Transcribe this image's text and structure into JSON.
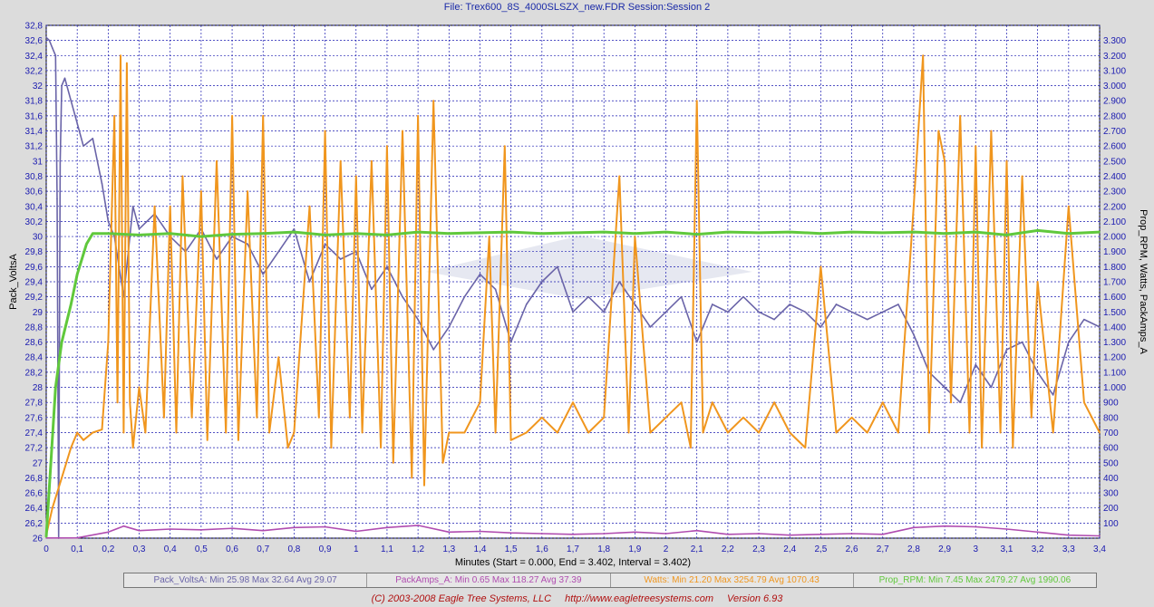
{
  "header": {
    "title": "File: Trex600_8S_4000SLSZX_new.FDR   Session:Session 2"
  },
  "footer": {
    "copyright": "(C) 2003-2008 Eagle Tree Systems, LLC",
    "url": "http://www.eagletreesystems.com",
    "version": "Version 6.93"
  },
  "legend": [
    {
      "text": "Pack_VoltsA:  Min 25.98    Max 32.64    Avg 29.07",
      "color": "#6a64a8"
    },
    {
      "text": "PackAmps_A:  Min 0.65    Max 118.27    Avg 37.39",
      "color": "#b04cb0"
    },
    {
      "text": "Watts:  Min 21.20    Max 3254.79    Avg 1070.43",
      "color": "#f0961e"
    },
    {
      "text": "Prop_RPM:  Min 7.45    Max 2479.27    Avg 1990.06",
      "color": "#60c83c"
    }
  ],
  "chart_data": {
    "type": "line",
    "xlabel": "Minutes (Start = 0.000,  End = 3.402,  Interval =  3.402)",
    "ylabel": "Pack_VoltsA",
    "y2label": "Prop_RPM, Watts, PackAmps_A",
    "xlim": [
      0,
      3.4
    ],
    "ylim": [
      26,
      32.8
    ],
    "y2lim": [
      0,
      3400
    ],
    "grid": true,
    "legend_position": "bottom",
    "x_ticks": [
      "0",
      "0,1",
      "0,2",
      "0,3",
      "0,4",
      "0,5",
      "0,6",
      "0,7",
      "0,8",
      "0,9",
      "1",
      "1,1",
      "1,2",
      "1,3",
      "1,4",
      "1,5",
      "1,6",
      "1,7",
      "1,8",
      "1,9",
      "2",
      "2,1",
      "2,2",
      "2,3",
      "2,4",
      "2,5",
      "2,6",
      "2,7",
      "2,8",
      "2,9",
      "3",
      "3,1",
      "3,2",
      "3,3",
      "3,4"
    ],
    "y_ticks": [
      "26",
      "26,2",
      "26,4",
      "26,6",
      "26,8",
      "27",
      "27,2",
      "27,4",
      "27,6",
      "27,8",
      "28",
      "28,2",
      "28,4",
      "28,6",
      "28,8",
      "29",
      "29,2",
      "29,4",
      "29,6",
      "29,8",
      "30",
      "30,2",
      "30,4",
      "30,6",
      "30,8",
      "31",
      "31,2",
      "31,4",
      "31,6",
      "31,8",
      "32",
      "32,2",
      "32,4",
      "32,6",
      "32,8"
    ],
    "y2_ticks": [
      "100",
      "200",
      "300",
      "400",
      "500",
      "600",
      "700",
      "800",
      "900",
      "1.000",
      "1.100",
      "1.200",
      "1.300",
      "1.400",
      "1.500",
      "1.600",
      "1.700",
      "1.800",
      "1.900",
      "2.000",
      "2.100",
      "2.200",
      "2.300",
      "2.400",
      "2.500",
      "2.600",
      "2.700",
      "2.800",
      "2.900",
      "3.000",
      "3.100",
      "3.200",
      "3.300"
    ],
    "series": [
      {
        "name": "Pack_VoltsA",
        "axis": "left",
        "color": "#6a64a8",
        "x": [
          0,
          0.01,
          0.02,
          0.03,
          0.035,
          0.04,
          0.045,
          0.05,
          0.06,
          0.08,
          0.1,
          0.12,
          0.15,
          0.18,
          0.2,
          0.22,
          0.25,
          0.28,
          0.3,
          0.35,
          0.4,
          0.45,
          0.5,
          0.55,
          0.6,
          0.65,
          0.7,
          0.75,
          0.8,
          0.85,
          0.9,
          0.95,
          1.0,
          1.05,
          1.1,
          1.15,
          1.2,
          1.25,
          1.3,
          1.35,
          1.4,
          1.45,
          1.5,
          1.55,
          1.6,
          1.65,
          1.7,
          1.75,
          1.8,
          1.85,
          1.9,
          1.95,
          2.0,
          2.05,
          2.1,
          2.15,
          2.2,
          2.25,
          2.3,
          2.35,
          2.4,
          2.45,
          2.5,
          2.55,
          2.6,
          2.65,
          2.7,
          2.75,
          2.8,
          2.85,
          2.9,
          2.95,
          3.0,
          3.05,
          3.1,
          3.15,
          3.2,
          3.25,
          3.3,
          3.35,
          3.4
        ],
        "y": [
          32.64,
          32.6,
          32.5,
          32.4,
          30.5,
          26.0,
          31.0,
          32.0,
          32.1,
          31.8,
          31.5,
          31.2,
          31.3,
          30.7,
          30.2,
          30.0,
          29.2,
          30.4,
          30.1,
          30.3,
          30.0,
          29.8,
          30.1,
          29.7,
          30.0,
          29.9,
          29.5,
          29.8,
          30.1,
          29.4,
          29.9,
          29.7,
          29.8,
          29.3,
          29.6,
          29.2,
          28.9,
          28.5,
          28.8,
          29.2,
          29.5,
          29.3,
          28.6,
          29.1,
          29.4,
          29.6,
          29.0,
          29.2,
          29.0,
          29.4,
          29.1,
          28.8,
          29.0,
          29.2,
          28.6,
          29.1,
          29.0,
          29.2,
          29.0,
          28.9,
          29.1,
          29.0,
          28.8,
          29.1,
          29.0,
          28.9,
          29.0,
          29.1,
          28.7,
          28.2,
          28.0,
          27.8,
          28.3,
          28.0,
          28.5,
          28.6,
          28.2,
          27.9,
          28.6,
          28.9,
          28.8
        ]
      },
      {
        "name": "PackAmps_A",
        "axis": "right",
        "color": "#b04cb0",
        "x": [
          0,
          0.1,
          0.2,
          0.25,
          0.3,
          0.4,
          0.5,
          0.6,
          0.7,
          0.8,
          0.9,
          1.0,
          1.1,
          1.2,
          1.3,
          1.4,
          1.5,
          1.6,
          1.7,
          1.8,
          1.9,
          2.0,
          2.1,
          2.2,
          2.3,
          2.4,
          2.5,
          2.6,
          2.7,
          2.8,
          2.9,
          3.0,
          3.1,
          3.2,
          3.3,
          3.4
        ],
        "y": [
          1,
          2,
          40,
          80,
          50,
          60,
          55,
          65,
          50,
          70,
          75,
          45,
          70,
          85,
          40,
          45,
          35,
          30,
          25,
          30,
          40,
          30,
          50,
          25,
          30,
          20,
          25,
          30,
          25,
          70,
          80,
          75,
          60,
          40,
          20,
          15
        ]
      },
      {
        "name": "Watts",
        "axis": "right",
        "color": "#f0961e",
        "x": [
          0,
          0.02,
          0.05,
          0.08,
          0.1,
          0.12,
          0.15,
          0.18,
          0.2,
          0.22,
          0.23,
          0.24,
          0.25,
          0.26,
          0.27,
          0.28,
          0.3,
          0.32,
          0.35,
          0.38,
          0.4,
          0.42,
          0.44,
          0.47,
          0.5,
          0.52,
          0.55,
          0.58,
          0.6,
          0.62,
          0.65,
          0.68,
          0.7,
          0.72,
          0.75,
          0.78,
          0.8,
          0.85,
          0.88,
          0.9,
          0.92,
          0.95,
          0.98,
          1.0,
          1.02,
          1.05,
          1.08,
          1.1,
          1.12,
          1.15,
          1.18,
          1.2,
          1.22,
          1.25,
          1.28,
          1.3,
          1.35,
          1.4,
          1.43,
          1.45,
          1.48,
          1.5,
          1.55,
          1.6,
          1.65,
          1.7,
          1.75,
          1.8,
          1.85,
          1.88,
          1.9,
          1.95,
          2.0,
          2.05,
          2.08,
          2.1,
          2.12,
          2.15,
          2.2,
          2.25,
          2.3,
          2.35,
          2.4,
          2.45,
          2.5,
          2.55,
          2.6,
          2.65,
          2.7,
          2.75,
          2.8,
          2.83,
          2.85,
          2.88,
          2.9,
          2.92,
          2.95,
          2.98,
          3.0,
          3.02,
          3.05,
          3.08,
          3.1,
          3.12,
          3.15,
          3.18,
          3.2,
          3.25,
          3.3,
          3.35,
          3.4
        ],
        "y": [
          20,
          200,
          400,
          600,
          700,
          650,
          700,
          720,
          1300,
          2800,
          900,
          3200,
          700,
          3150,
          900,
          600,
          1000,
          700,
          2200,
          800,
          2200,
          700,
          2400,
          800,
          2300,
          650,
          2500,
          700,
          2800,
          650,
          2300,
          800,
          2800,
          700,
          1200,
          600,
          700,
          2200,
          800,
          2700,
          600,
          2500,
          800,
          2400,
          700,
          2500,
          600,
          2600,
          500,
          2700,
          400,
          2800,
          350,
          2900,
          500,
          700,
          700,
          900,
          2000,
          700,
          2600,
          650,
          700,
          800,
          700,
          900,
          700,
          800,
          2400,
          700,
          2000,
          700,
          800,
          900,
          600,
          2900,
          700,
          900,
          700,
          800,
          700,
          900,
          700,
          600,
          1800,
          700,
          800,
          700,
          900,
          700,
          2200,
          3200,
          700,
          2700,
          2500,
          900,
          2800,
          700,
          2600,
          600,
          2700,
          700,
          2500,
          600,
          2400,
          800,
          1700,
          700,
          2200,
          900,
          700
        ]
      },
      {
        "name": "Prop_RPM",
        "axis": "right",
        "color": "#60c83c",
        "x": [
          0,
          0.03,
          0.05,
          0.08,
          0.1,
          0.13,
          0.15,
          0.2,
          0.3,
          0.4,
          0.5,
          0.6,
          0.7,
          0.8,
          0.9,
          1.0,
          1.1,
          1.2,
          1.3,
          1.4,
          1.5,
          1.6,
          1.7,
          1.8,
          1.9,
          2.0,
          2.1,
          2.2,
          2.3,
          2.4,
          2.5,
          2.6,
          2.7,
          2.8,
          2.9,
          3.0,
          3.1,
          3.2,
          3.3,
          3.4
        ],
        "y": [
          7,
          1000,
          1300,
          1550,
          1750,
          1950,
          2020,
          2020,
          2010,
          2020,
          2000,
          2015,
          2020,
          2030,
          2010,
          2020,
          2010,
          2030,
          2020,
          2025,
          2030,
          2020,
          2025,
          2030,
          2020,
          2030,
          2015,
          2030,
          2025,
          2030,
          2020,
          2030,
          2025,
          2030,
          2020,
          2030,
          2010,
          2040,
          2020,
          2030
        ]
      }
    ]
  }
}
